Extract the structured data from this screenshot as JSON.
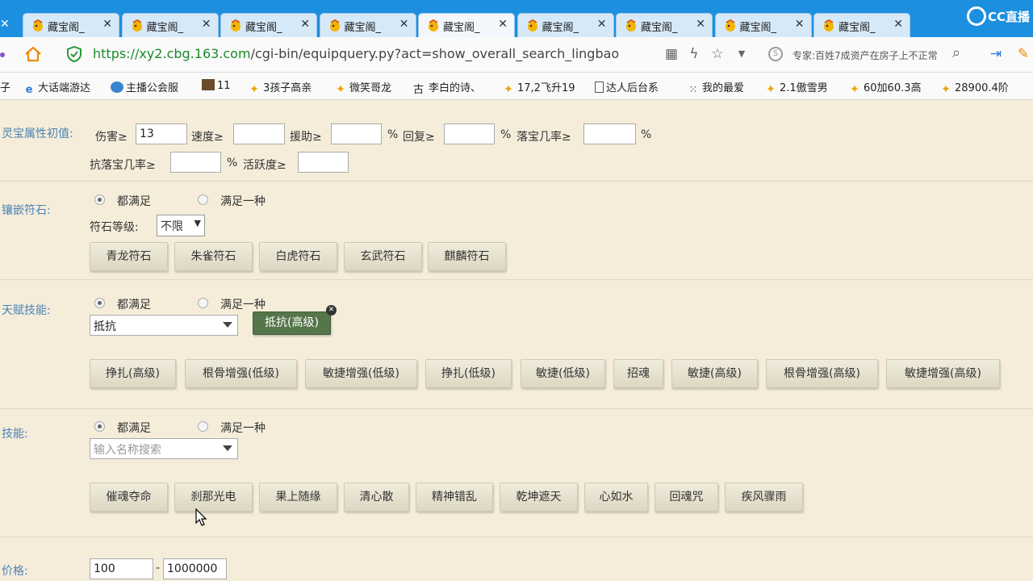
{
  "browser": {
    "tab_label": "藏宝阁_",
    "tab_close": "✕",
    "tab_count": 9,
    "active_tab_index": 4,
    "cc_brand": "CC直播",
    "url_prefix": "https://",
    "url_host": "xy2.cbg.163.com",
    "url_path": "/cgi-bin/equipquery.py?act=show_overall_search_lingbao",
    "search_text": "专家:百姓7成资产在房子上不正常",
    "bookmarks": [
      "子",
      "大话端游达",
      "主播公会服",
      "11",
      "3孩子高亲",
      "微笑哥龙",
      "李白的诗、",
      "17,2飞升19",
      "达人后台系",
      "我的最爱",
      "2.1傲雪男",
      "60加60.3高",
      "28900.4阶"
    ]
  },
  "lingbao": {
    "label": "灵宝属性初值:",
    "damage_label": "伤害≥",
    "damage_value": "13",
    "speed_label": "速度≥",
    "aid_label": "援助≥",
    "recover_label": "回复≥",
    "drop_label": "落宝几率≥",
    "anti_drop_label": "抗落宝几率≥",
    "active_label": "活跃度≥",
    "pct": "%"
  },
  "rune": {
    "label": "镶嵌符石:",
    "opt_all": "都满足",
    "opt_any": "满足一种",
    "level_label": "符石等级:",
    "level_value": "不限",
    "buttons": [
      "青龙符石",
      "朱雀符石",
      "白虎符石",
      "玄武符石",
      "麒麟符石"
    ]
  },
  "talent": {
    "label": "天赋技能:",
    "opt_all": "都满足",
    "opt_any": "满足一种",
    "select_value": "抵抗",
    "chip": "抵抗(高级)",
    "buttons": [
      "挣扎(高级)",
      "根骨增强(低级)",
      "敏捷增强(低级)",
      "挣扎(低级)",
      "敏捷(低级)",
      "招魂",
      "敏捷(高级)",
      "根骨增强(高级)",
      "敏捷增强(高级)"
    ]
  },
  "skill": {
    "label": "技能:",
    "opt_all": "都满足",
    "opt_any": "满足一种",
    "placeholder": "输入名称搜索",
    "buttons": [
      "催魂夺命",
      "刹那光电",
      "果上随缘",
      "清心散",
      "精神错乱",
      "乾坤遮天",
      "心如水",
      "回魂咒",
      "疾风骤雨"
    ]
  },
  "price": {
    "label": "价格:",
    "min": "100",
    "sep": "-",
    "max": "1000000"
  }
}
